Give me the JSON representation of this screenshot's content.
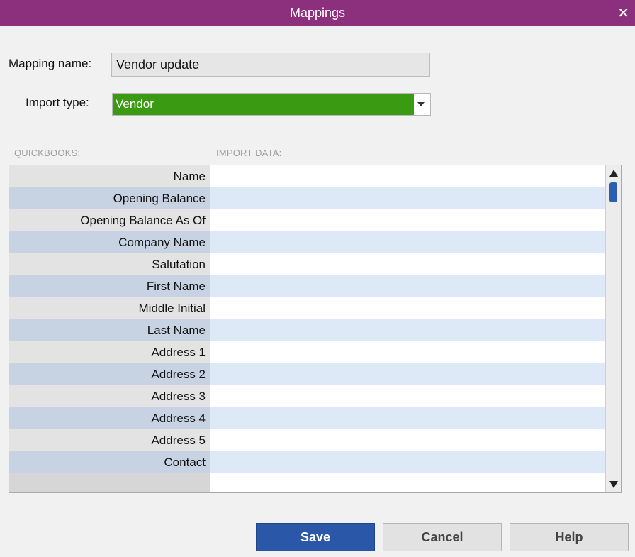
{
  "window": {
    "title": "Mappings",
    "close_glyph": "✕"
  },
  "form": {
    "mapping_name_label": "Mapping name:",
    "mapping_name_value": "Vendor update",
    "import_type_label": "Import type:",
    "import_type_value": "Vendor"
  },
  "grid": {
    "headers": {
      "quickbooks": "QUICKBOOKS:",
      "import_data": "IMPORT DATA:"
    },
    "rows": [
      "Name",
      "Opening Balance",
      "Opening Balance As Of",
      "Company Name",
      "Salutation",
      "First Name",
      "Middle Initial",
      "Last Name",
      "Address 1",
      "Address 2",
      "Address 3",
      "Address 4",
      "Address 5",
      "Contact"
    ]
  },
  "buttons": {
    "save": "Save",
    "cancel": "Cancel",
    "help": "Help"
  },
  "colors": {
    "titlebar": "#8c2f7d",
    "selected_type": "#3a9a12",
    "primary_button": "#2b57a8",
    "alt_row": "#dde9f7"
  }
}
